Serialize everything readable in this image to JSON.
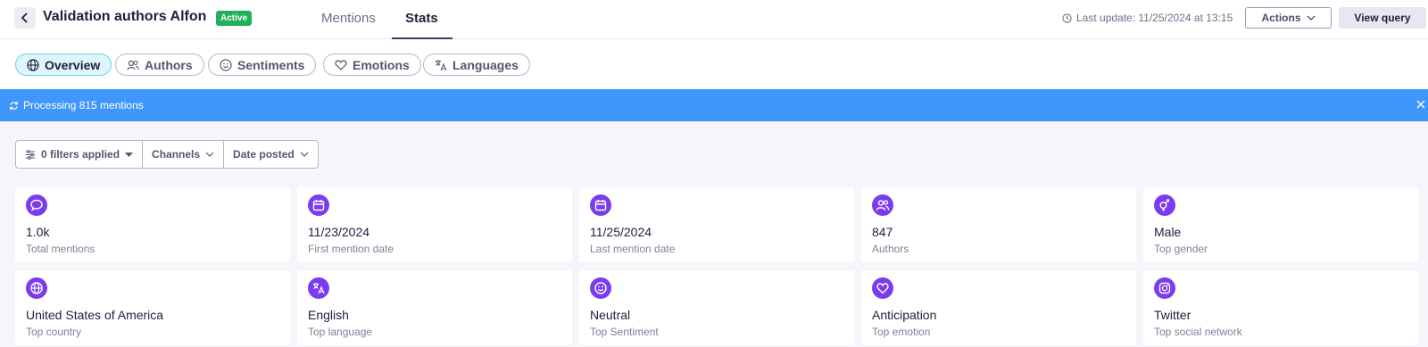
{
  "header": {
    "title": "Validation authors Alfon",
    "status_badge": "Active",
    "tabs": [
      {
        "label": "Mentions",
        "active": false
      },
      {
        "label": "Stats",
        "active": true
      }
    ],
    "last_update": "Last update: 11/25/2024 at 13:15",
    "actions_label": "Actions",
    "view_query_label": "View query"
  },
  "subtabs": [
    {
      "label": "Overview",
      "icon": "globe-icon",
      "active": true
    },
    {
      "label": "Authors",
      "icon": "users-icon",
      "active": false
    },
    {
      "label": "Sentiments",
      "icon": "smile-icon",
      "active": false
    },
    {
      "label": "Emotions",
      "icon": "heart-icon",
      "active": false
    },
    {
      "label": "Languages",
      "icon": "translate-icon",
      "active": false
    }
  ],
  "banner": {
    "text": "Processing 815 mentions"
  },
  "filters": {
    "applied": "0 filters applied",
    "channels": "Channels",
    "date_posted": "Date posted"
  },
  "stats": [
    {
      "value": "1.0k",
      "label": "Total mentions",
      "icon": "speech-bubble-icon"
    },
    {
      "value": "11/23/2024",
      "label": "First mention date",
      "icon": "calendar-icon"
    },
    {
      "value": "11/25/2024",
      "label": "Last mention date",
      "icon": "calendar-icon"
    },
    {
      "value": "847",
      "label": "Authors",
      "icon": "users-icon"
    },
    {
      "value": "Male",
      "label": "Top gender",
      "icon": "gender-icon"
    },
    {
      "value": "United States of America",
      "label": "Top country",
      "icon": "globe-icon"
    },
    {
      "value": "English",
      "label": "Top language",
      "icon": "translate-icon"
    },
    {
      "value": "Neutral",
      "label": "Top Sentiment",
      "icon": "smile-icon"
    },
    {
      "value": "Anticipation",
      "label": "Top emotion",
      "icon": "heart-icon"
    },
    {
      "value": "Twitter",
      "label": "Top social network",
      "icon": "instagram-icon"
    }
  ],
  "colors": {
    "accent": "#7a3cf0",
    "banner": "#3f97fb",
    "active_badge": "#22b05b"
  }
}
